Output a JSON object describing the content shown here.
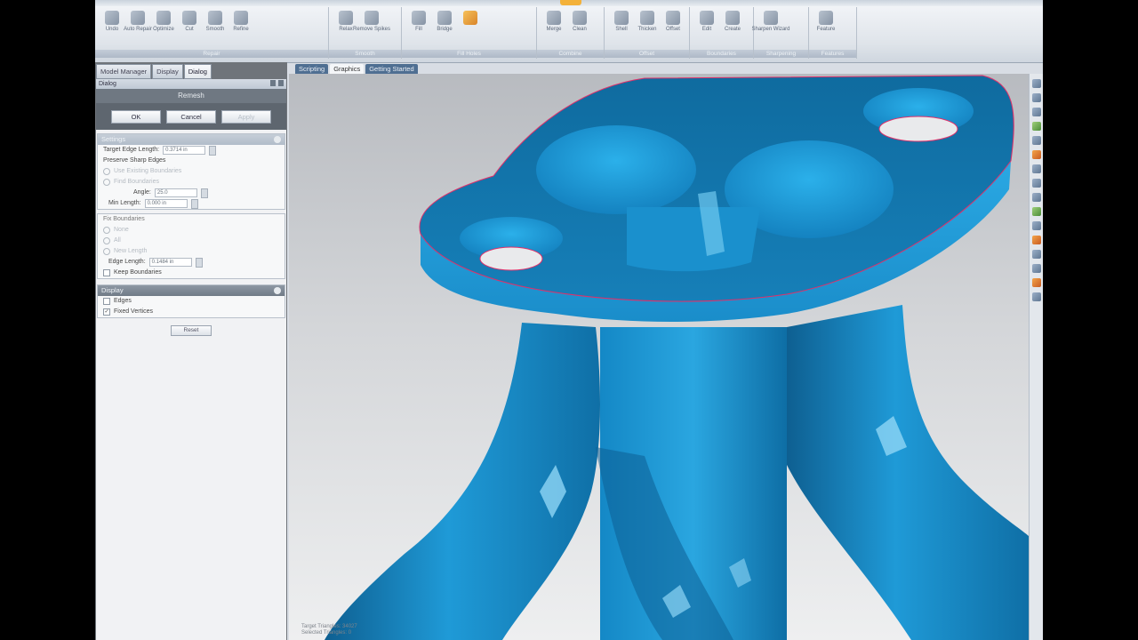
{
  "ribbon": {
    "groups": [
      {
        "label": "Repair",
        "buttons": [
          "Undo",
          "Auto Repair",
          "Optimize",
          "Cut",
          "Smooth",
          "Refine"
        ]
      },
      {
        "label": "Smooth",
        "buttons": [
          "Relax",
          "Remove Spikes"
        ]
      },
      {
        "label": "Fill Holes",
        "buttons": [
          "Fill",
          "Bridge"
        ]
      },
      {
        "label": "Combine",
        "buttons": [
          "Merge",
          "Clean"
        ]
      },
      {
        "label": "Offset",
        "buttons": [
          "Shell",
          "Thicken",
          "Offset"
        ]
      },
      {
        "label": "Boundaries",
        "buttons": [
          "Edit",
          "Create"
        ]
      },
      {
        "label": "Sharpening",
        "buttons": [
          "Sharpen Wizard"
        ]
      },
      {
        "label": "Features",
        "buttons": [
          "Feature"
        ]
      }
    ]
  },
  "panel": {
    "tabs": [
      "Model Manager",
      "Display",
      "Dialog"
    ],
    "active_tab": "Dialog",
    "dialog_title": "Dialog",
    "dialog_name": "Remesh",
    "ok": "OK",
    "cancel": "Cancel",
    "apply": "Apply",
    "settings_header": "Settings",
    "target_edge_length_label": "Target Edge Length:",
    "target_edge_length_value": "0.3714 in",
    "preserve_sharp_edges": "Preserve Sharp Edges",
    "use_existing_label": "Use Existing Boundaries",
    "find_boundaries_label": "Find Boundaries",
    "angle_label": "Angle:",
    "angle_value": "25.0",
    "min_length_label": "Min Length:",
    "min_length_value": "0.000 in",
    "fix_boundaries_header": "Fix Boundaries",
    "none_label": "None",
    "all_label": "All",
    "new_length_label": "New Length",
    "edge_length_label": "Edge Length:",
    "edge_length_value": "0.1484 in",
    "keep_boundaries": "Keep Boundaries",
    "display_header": "Display",
    "edges_label": "Edges",
    "fixed_vertices_label": "Fixed Vertices",
    "reset": "Reset"
  },
  "viewport": {
    "tabs": [
      "Scripting",
      "Graphics",
      "Getting Started"
    ],
    "active_tab": "Graphics",
    "status_line1": "Target Triangles: 34027",
    "status_line2": "Selected Triangles: 0"
  },
  "colors": {
    "mesh_blue": "#1e9ad6",
    "mesh_dark": "#0f6fa6",
    "boundary_red": "#e0306a",
    "accent_orange": "#f3b13a"
  }
}
